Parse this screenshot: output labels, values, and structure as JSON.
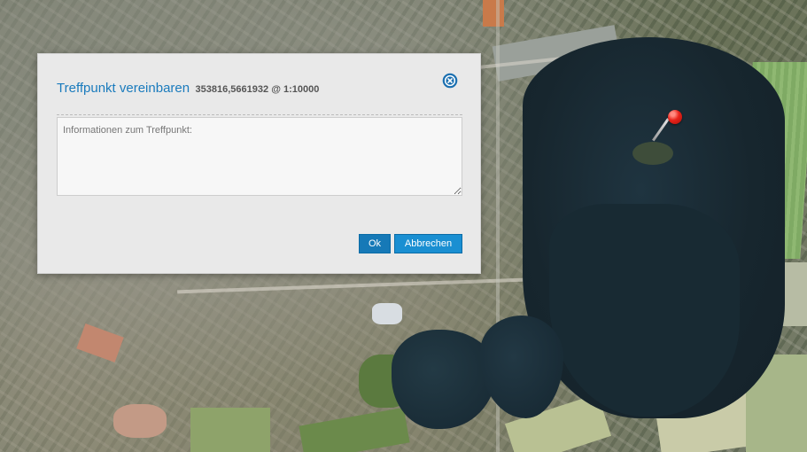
{
  "dialog": {
    "title": "Treffpunkt vereinbaren",
    "coordinates": "353816,5661932 @ 1:10000",
    "textarea_placeholder": "Informationen zum Treffpunkt:",
    "textarea_value": "",
    "ok_label": "Ok",
    "cancel_label": "Abbrechen",
    "close_icon": "close-circle-icon",
    "accent_color": "#1a7bbd"
  },
  "map": {
    "type": "aerial-photo",
    "marker_icon": "map-pin-icon",
    "marker_color": "#e8231a"
  }
}
